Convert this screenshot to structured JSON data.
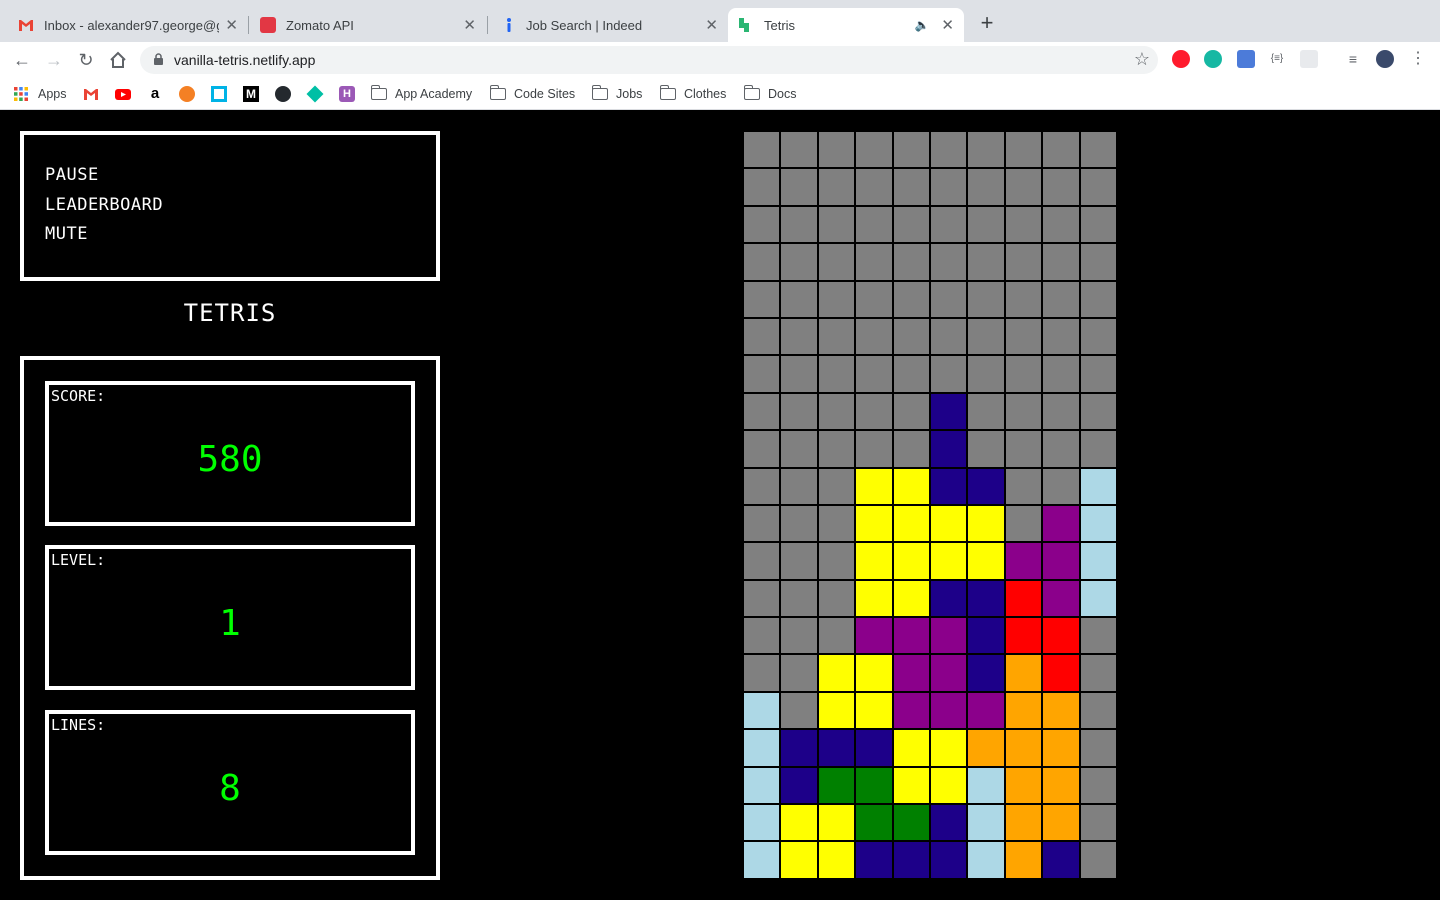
{
  "browser": {
    "tabs": [
      {
        "title": "Inbox - alexander97.george@g",
        "favicon": "gmail-icon",
        "active": false
      },
      {
        "title": "Zomato API",
        "favicon": "zomato-icon",
        "active": false
      },
      {
        "title": "Job Search | Indeed",
        "favicon": "indeed-icon",
        "active": false
      },
      {
        "title": "Tetris",
        "favicon": "tetris-icon",
        "active": true
      }
    ],
    "url": "vanilla-tetris.netlify.app",
    "bookmarks": {
      "apps_label": "Apps",
      "folders": [
        "App Academy",
        "Code Sites",
        "Jobs",
        "Clothes",
        "Docs"
      ]
    }
  },
  "menu": {
    "pause": "PAUSE",
    "leaderboard": "LEADERBOARD",
    "mute": "MUTE"
  },
  "title": "TETRIS",
  "stats": {
    "score_label": "SCORE:",
    "score": "580",
    "level_label": "LEVEL:",
    "level": "1",
    "lines_label": "LINES:",
    "lines": "8"
  },
  "colors": {
    "empty": "#808080",
    "B": "#1d0089",
    "Y": "#ffff00",
    "C": "#add8e6",
    "P": "#8b008b",
    "R": "#ff0000",
    "O": "#ffa500",
    "G": "#008000"
  },
  "board": [
    "..........",
    "..........",
    "..........",
    "..........",
    "..........",
    "..........",
    "..........",
    ".....B....",
    ".....B....",
    "...YYBB..C",
    "...YYYY.PC",
    "...YYYYPPC",
    "...YYBBRPC",
    "...PPPBRR.",
    "..YYPPBOR.",
    "C.YYPPPOO.",
    "CBBBYYOOO.",
    "CBGGYYCOO.",
    "CYYGGBCOO.",
    "CYYBBBCOB."
  ]
}
